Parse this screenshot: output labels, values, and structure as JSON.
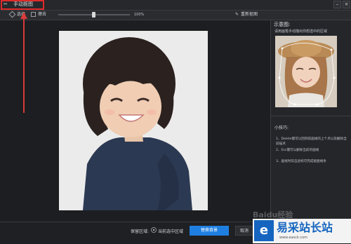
{
  "window": {
    "title": "手动抠图",
    "title_icon": "scissors-icon"
  },
  "window_controls": {
    "minimize": "–",
    "close": "×"
  },
  "toolbar": {
    "select_label": "选择",
    "erase_label": "擦去",
    "zoom_value": "100%",
    "zoom_fraction": 0.48,
    "reset_label": "重新抠图"
  },
  "panel": {
    "title": "示意图:",
    "desc": "请用画笔手动描出你想选中的区域",
    "tips_title": "小技巧:",
    "tips": [
      "1、Delete键可以回到前画线的上个点以及删除当前描点",
      "2、Esc键可以删除当前的画线",
      "3、画线时双击鼠标可完成抠图线条"
    ]
  },
  "bottom": {
    "selection_label": "保留区域:",
    "option_selected": "当前选中区域",
    "option_unselected": "非选中区域",
    "replace_button": "替换背景",
    "cancel_button": "取消"
  },
  "watermark": {
    "baidu": "Baidu经验",
    "logo_letter": "e",
    "site_name": "易采站长站",
    "url": "www.easck.com"
  },
  "colors": {
    "accent": "#1f7fe0",
    "annotation": "#e02a2a",
    "background": "#1e1f22"
  }
}
